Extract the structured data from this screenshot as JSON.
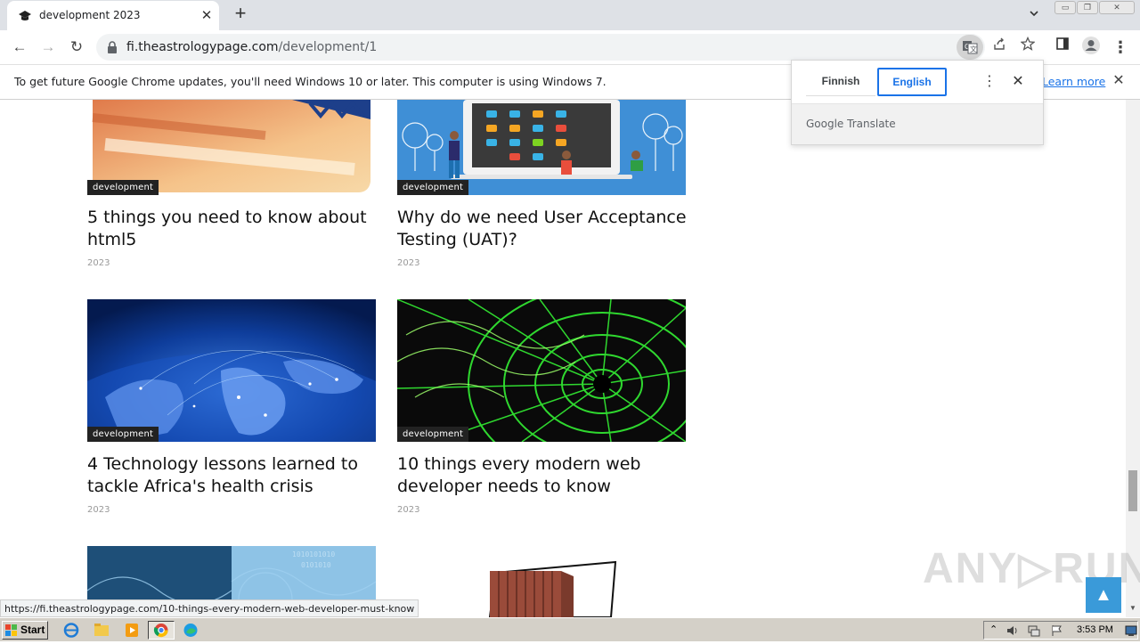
{
  "tab": {
    "title": "development 2023",
    "close_glyph": "✕",
    "new_tab_glyph": "+"
  },
  "window_controls": {
    "minimize": "▭",
    "restore": "❐",
    "close": "✕"
  },
  "toolbar": {
    "back_glyph": "←",
    "forward_glyph": "→",
    "reload_glyph": "↻",
    "url_domain": "fi.theastrologypage.com",
    "url_path": "/development/1"
  },
  "infobar": {
    "message": "To get future Google Chrome updates, you'll need Windows 10 or later. This computer is using Windows 7.",
    "learn_more": "Learn more",
    "close_glyph": "✕"
  },
  "translate": {
    "source_language": "Finnish",
    "target_language": "English",
    "brand_google": "Google",
    "brand_translate": " Translate",
    "menu_glyph": "⋮",
    "close_glyph": "✕"
  },
  "articles": [
    {
      "category": "development",
      "title": "5 things you need to know about html5",
      "year": "2023"
    },
    {
      "category": "development",
      "title": "Why do we need User Acceptance Testing (UAT)?",
      "year": "2023"
    },
    {
      "category": "development",
      "title": "4 Technology lessons learned to tackle Africa's health crisis",
      "year": "2023"
    },
    {
      "category": "development",
      "title": "10 things every modern web developer needs to know",
      "year": "2023"
    }
  ],
  "status_url": "https://fi.theastrologypage.com/10-things-every-modern-web-developer-must-know",
  "watermark": "ANY▷RUN",
  "back_to_top_glyph": "▲",
  "taskbar": {
    "start_label": "Start",
    "clock": "3:53 PM"
  },
  "colors": {
    "accent_blue": "#1a73e8",
    "badge_bg": "#222222",
    "back_to_top": "#3a9ad9"
  }
}
